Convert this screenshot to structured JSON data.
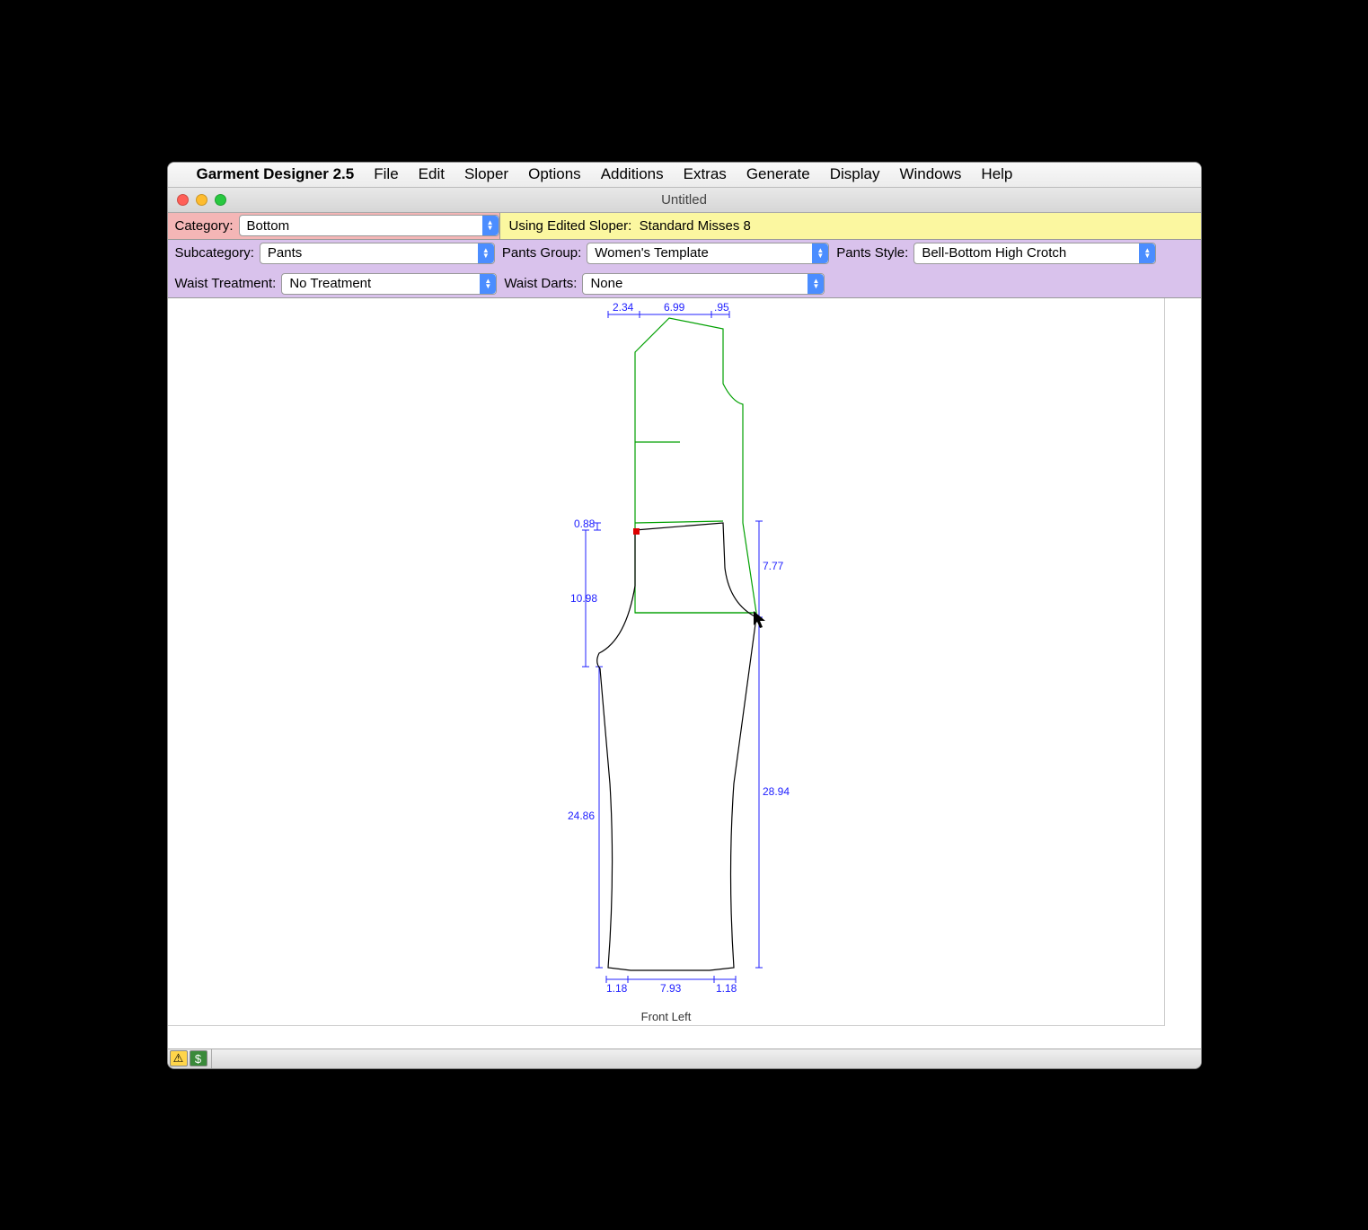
{
  "menubar": {
    "app_name": "Garment Designer 2.5",
    "items": [
      "File",
      "Edit",
      "Sloper",
      "Options",
      "Additions",
      "Extras",
      "Generate",
      "Display",
      "Windows",
      "Help"
    ]
  },
  "window": {
    "title": "Untitled"
  },
  "category": {
    "label": "Category:",
    "value": "Bottom"
  },
  "sloper_status": {
    "label": "Using Edited Sloper:",
    "value": "Standard Misses 8"
  },
  "subcategory": {
    "label": "Subcategory:",
    "value": "Pants"
  },
  "pants_group": {
    "label": "Pants Group:",
    "value": "Women's Template"
  },
  "pants_style": {
    "label": "Pants Style:",
    "value": "Bell-Bottom High Crotch"
  },
  "waist_treatment": {
    "label": "Waist Treatment:",
    "value": "No Treatment"
  },
  "waist_darts": {
    "label": "Waist Darts:",
    "value": "None"
  },
  "canvas": {
    "view_label": "Front Left",
    "dims": {
      "top_a": "2.34",
      "top_b": "6.99",
      "top_c": ".95",
      "waist_drop": "0.88",
      "left_upper": "10.98",
      "left_lower": "24.86",
      "right_upper": "7.77",
      "right_lower": "28.94",
      "bottom_a": "1.18",
      "bottom_b": "7.93",
      "bottom_c": "1.18"
    }
  }
}
